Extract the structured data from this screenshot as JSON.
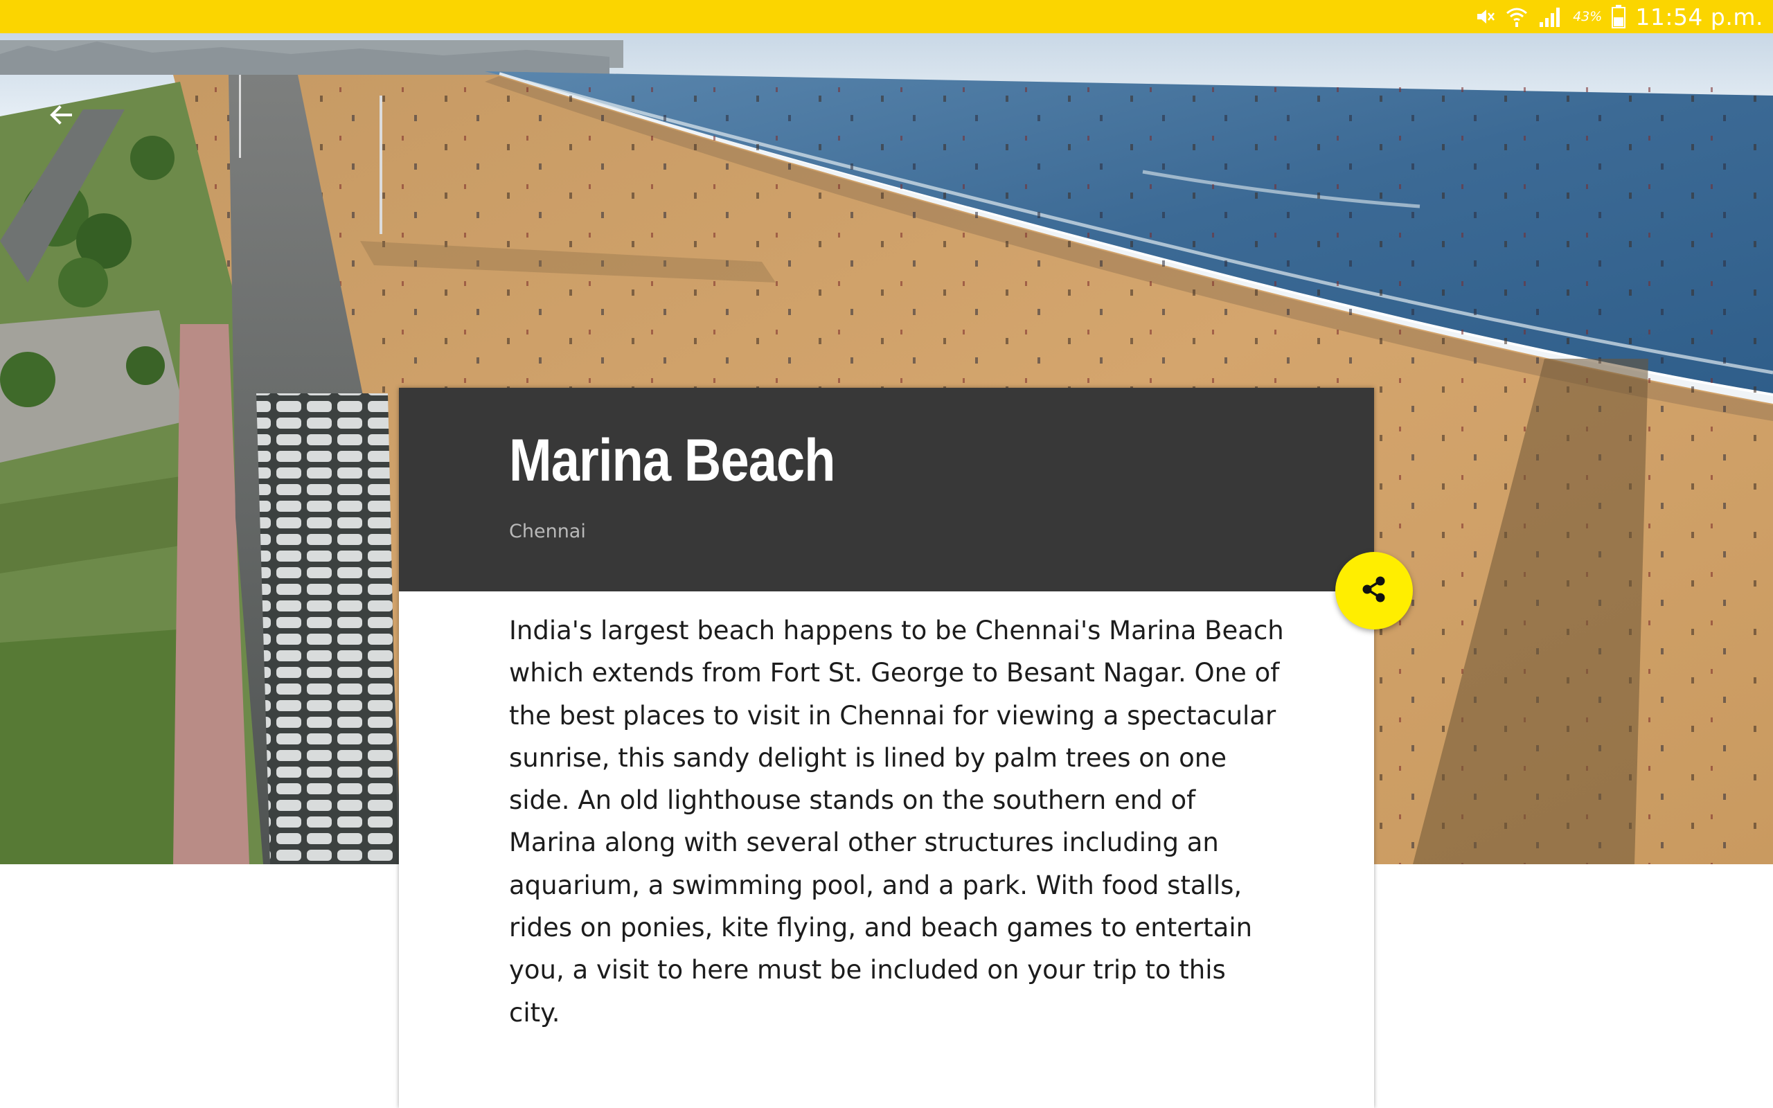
{
  "status_bar": {
    "battery_percent": "43%",
    "time": "11:54 p.m.",
    "icons": [
      "mute-icon",
      "wifi-icon",
      "signal-icon",
      "battery-icon"
    ]
  },
  "navigation": {
    "back_icon": "arrow-left-icon"
  },
  "place": {
    "title": "Marina Beach",
    "city": "Chennai",
    "description": "India's largest beach happens to be Chennai's Marina Beach which extends from Fort St. George to Besant Nagar. One of the best places to visit in Chennai for viewing a spectacular sunrise, this sandy delight is lined by palm trees on one side. An old lighthouse stands on the southern end of Marina along with several other structures including an aquarium, a swimming pool, and a park. With food stalls, rides on ponies, kite flying, and beach games to entertain you, a visit to here must be included on your trip to this city."
  },
  "share": {
    "icon": "share-icon"
  },
  "colors": {
    "status_bar": "#fbd500",
    "card_header": "#383838",
    "fab": "#ffee00",
    "sand": "#cfa068",
    "sea": "#3e6b94"
  }
}
